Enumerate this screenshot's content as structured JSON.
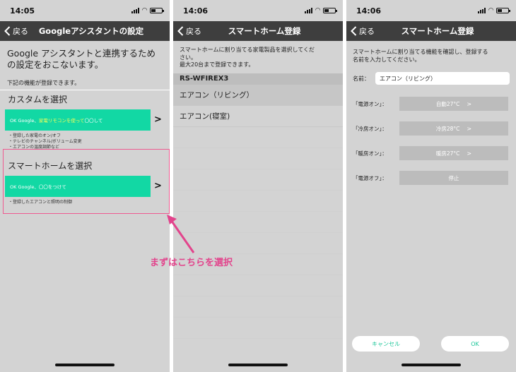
{
  "screens": [
    {
      "time": "14:05",
      "back_label": "戻る",
      "title": "Googleアシスタントの設定",
      "intro": "Google アシスタントと連携するための設定をおこないます。",
      "note": "下記の機能が登録できます。",
      "custom": {
        "title": "カスタムを選択",
        "cmd_prefix": "OK Google、",
        "cmd_highlight": "家電リモコンを使って",
        "cmd_suffix": "〇〇して",
        "bullets": [
          "・登録した家電のオン/オフ",
          "・テレビのチャンネル/ボリューム変更",
          "・エアコンの温度調節など"
        ]
      },
      "smarthome": {
        "title": "スマートホームを選択",
        "cmd": "OK Google、〇〇をつけて",
        "bullets": [
          "・登録したエアコンと照明の制御"
        ]
      },
      "chevron": ">",
      "highlight_color": "#ef5b91"
    },
    {
      "time": "14:06",
      "back_label": "戻る",
      "title": "スマートホーム登録",
      "desc_lines": [
        "スマートホームに割り当てる家電製品を選択してくだ",
        "さい。",
        "最大20台まで登録できます。"
      ],
      "device_group": "RS-WFIREX3",
      "devices": [
        "エアコン（リビング）",
        "エアコン(寝室)"
      ]
    },
    {
      "time": "14:06",
      "back_label": "戻る",
      "title": "スマートホーム登録",
      "desc_lines": [
        "スマートホームに割り当てる機能を確認し、登録する",
        "名前を入力してください。"
      ],
      "name_label": "名前：",
      "name_value": "エアコン（リビング）",
      "actions": [
        {
          "label": "「電源オン」：",
          "value": "自動27°C",
          "chevron": ">"
        },
        {
          "label": "「冷房オン」：",
          "value": "冷房28°C",
          "chevron": ">"
        },
        {
          "label": "「暖房オン」：",
          "value": "暖房27°C",
          "chevron": ">"
        },
        {
          "label": "「電源オフ」：",
          "value": "停止",
          "chevron": ""
        }
      ],
      "cancel_label": "キャンセル",
      "ok_label": "OK"
    }
  ],
  "annotation": {
    "text": "まずはこちらを選択",
    "color": "#e2448c"
  },
  "colors": {
    "navbar": "#3e3e3e",
    "command_bar": "#12d8a4",
    "background": "#d3d3d3"
  }
}
